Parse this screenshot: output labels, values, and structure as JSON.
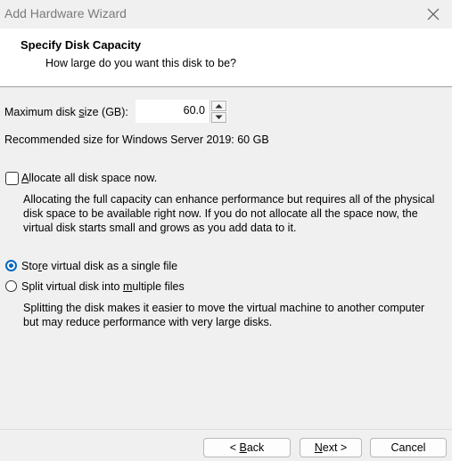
{
  "window": {
    "title": "Add Hardware Wizard",
    "close_icon": "close-icon"
  },
  "header": {
    "title": "Specify Disk Capacity",
    "subtitle": "How large do you want this disk to be?"
  },
  "disk_size": {
    "label_pre": "Maximum disk ",
    "label_mnemonic": "s",
    "label_post": "ize (GB):",
    "value": "60.0"
  },
  "recommended": "Recommended size for Windows Server 2019: 60 GB",
  "allocate": {
    "checked": false,
    "label_mnemonic": "A",
    "label_rest": "llocate all disk space now.",
    "description": "Allocating the full capacity can enhance performance but requires all of the physical disk space to be available right now. If you do not allocate all the space now, the virtual disk starts small and grows as you add data to it."
  },
  "storage": {
    "single": {
      "selected": true,
      "label_pre": "Sto",
      "label_mnemonic": "r",
      "label_post": "e virtual disk as a single file"
    },
    "multiple": {
      "selected": false,
      "label_pre": "Split virtual disk into ",
      "label_mnemonic": "m",
      "label_post": "ultiple files"
    },
    "description": "Splitting the disk makes it easier to move the virtual machine to another computer but may reduce performance with very large disks."
  },
  "buttons": {
    "back": {
      "pre": "< ",
      "mnemonic": "B",
      "post": "ack"
    },
    "next": {
      "pre": "",
      "mnemonic": "N",
      "post": "ext >"
    },
    "cancel": "Cancel"
  }
}
